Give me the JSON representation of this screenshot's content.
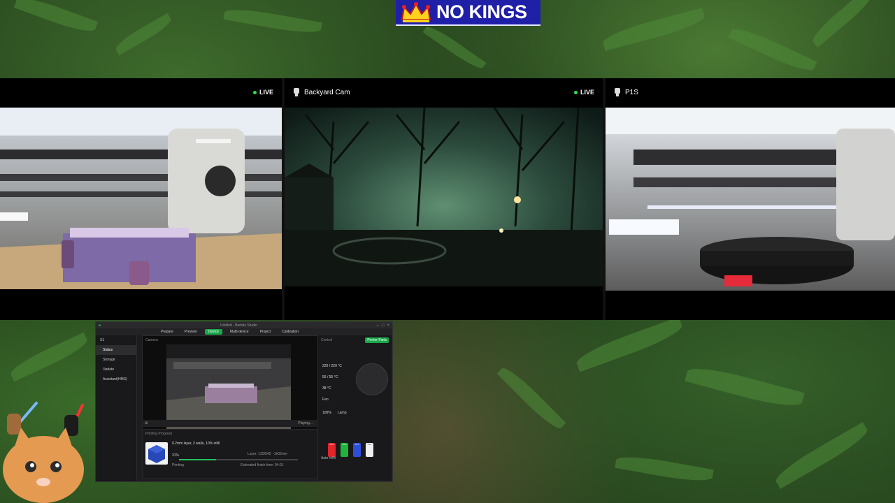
{
  "banner": {
    "text": "NO KINGS"
  },
  "cameras": [
    {
      "name": "",
      "live": "LIVE"
    },
    {
      "name": "Backyard Cam",
      "live": "LIVE"
    },
    {
      "name": "P1S",
      "live": ""
    }
  ],
  "studio": {
    "window_title": "Untitled - Bambu Studio",
    "tabs": [
      "Prepare",
      "Preview",
      "Device",
      "Multi-device",
      "Project",
      "Calibration"
    ],
    "active_tab": "Device",
    "sidebar": {
      "device": "X1",
      "items": [
        "Status",
        "Storage",
        "Update",
        "Assistant(HMS)"
      ]
    },
    "camera_label": "Camera",
    "playback_status": "Playing...",
    "progress_title": "Printing Progress",
    "job_description": "0.2mm layer, 2 walls, 10% infill",
    "layer": "Layer: 120/542",
    "time_left": "-1h02min",
    "percent": "31%",
    "progress_fraction": 0.31,
    "state": "Printing",
    "eta": "Estimated finish time: 04:01",
    "control_title": "Control",
    "printer_parts_label": "Printer Parts",
    "temps": [
      "220 / 220 °C",
      "55 / 55 °C",
      "38 °C"
    ],
    "fan_label": "Fan",
    "fan_value": "100%",
    "lamp_label": "Lamp",
    "ams_label": "Auto refill",
    "spools": [
      {
        "label": "PLA",
        "color": "#e0252b"
      },
      {
        "label": "PLA",
        "color": "#21b33c"
      },
      {
        "label": "PLA",
        "color": "#2d4fd8"
      },
      {
        "label": "PLA",
        "color": "#efefef"
      }
    ]
  }
}
